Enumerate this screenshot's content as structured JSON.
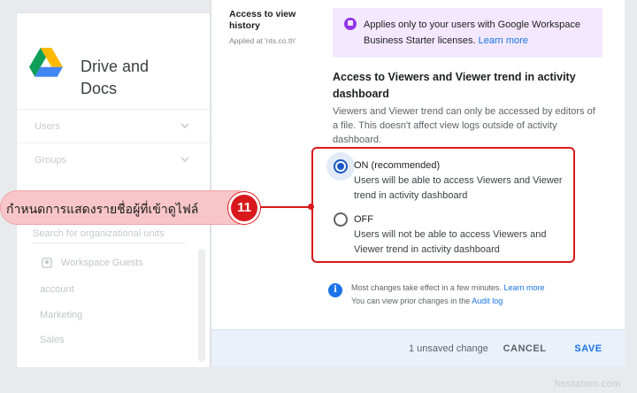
{
  "sidebar": {
    "app_title": "Drive and\nDocs",
    "rows": [
      "Users",
      "Groups"
    ],
    "search_placeholder": "Search for organizational units",
    "guest_item": "Workspace Guests",
    "org_units": [
      "account",
      "Marketing",
      "Sales"
    ]
  },
  "setting": {
    "name": "Access to view history",
    "applied_at": "Applied at 'nts.co.th'"
  },
  "notice": {
    "text": "Applies only to your users with Google Workspace Business Starter licenses.",
    "link": "Learn more"
  },
  "section": {
    "title": "Access to Viewers and Viewer trend in activity dashboard",
    "description": "Viewers and Viewer trend can only be accessed by editors of a file. This doesn't affect view logs outside of activity dashboard."
  },
  "options": [
    {
      "label": "ON (recommended)",
      "description": "Users will be able to access Viewers and Viewer trend in activity dashboard",
      "checked": true
    },
    {
      "label": "OFF",
      "description": "Users will not be able to access Viewers and Viewer trend in activity dashboard",
      "checked": false
    }
  ],
  "info": {
    "line1": "Most changes take effect in a few minutes.",
    "line1_link": "Learn more",
    "line2": "You can view prior changes in the",
    "line2_link": "Audit log"
  },
  "footer": {
    "unsaved": "1 unsaved change",
    "cancel": "CANCEL",
    "save": "SAVE"
  },
  "annotation": {
    "text": "กำหนดการแสดงรายชื่อผู้ที่เข้าดูไฟล์",
    "step": "11"
  },
  "watermark": "hostatom.com",
  "colors": {
    "accent": "#1a73e8",
    "radio_checked": "#1a56c5",
    "annotation_red": "#d7191c",
    "notice_bg": "#f3e8fd",
    "footer_bg": "#eaf1fb"
  }
}
